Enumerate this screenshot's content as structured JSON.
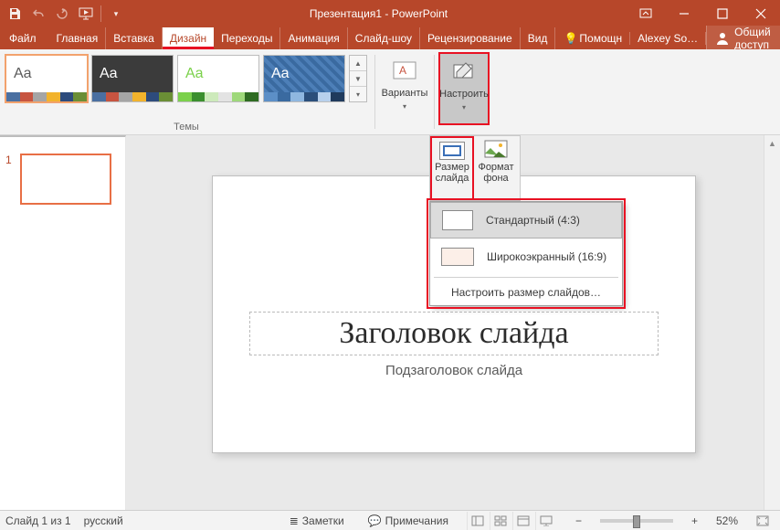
{
  "title": "Презентация1 - PowerPoint",
  "tabs": {
    "file": "Файл",
    "home": "Главная",
    "insert": "Вставка",
    "design": "Дизайн",
    "transitions": "Переходы",
    "animation": "Анимация",
    "slideshow": "Слайд-шоу",
    "review": "Рецензирование",
    "view": "Вид",
    "help": "Помощн",
    "account": "Alexey So…",
    "share": "Общий доступ"
  },
  "ribbon": {
    "themes_label": "Темы",
    "variants": "Варианты",
    "customize": "Настроить",
    "slide_size": "Размер слайда",
    "format_bg": "Формат фона"
  },
  "themes": [
    {
      "aa": "Aa",
      "color": "#5a5a5a",
      "bg": "#ffffff",
      "bars": [
        "#4a6fa1",
        "#c75440",
        "#a5a5a5",
        "#f2b32c",
        "#2d4b7c",
        "#6a8e35"
      ]
    },
    {
      "aa": "Aa",
      "color": "#ffffff",
      "bg": "#3b3b3b",
      "bars": [
        "#4a6fa1",
        "#c75440",
        "#a5a5a5",
        "#f2b32c",
        "#2d4b7c",
        "#6a8e35"
      ]
    },
    {
      "aa": "Aa",
      "color": "#7bd14b",
      "bg": "#ffffff",
      "bars": [
        "#7bd14b",
        "#3b8f2e",
        "#cdeabb",
        "#e3e3e3",
        "#9ed87a",
        "#2e6b22"
      ]
    },
    {
      "aa": "Aa",
      "color": "#ffffff",
      "bg": "pattern",
      "bars": [
        "#5c8fc7",
        "#3a6aa0",
        "#8fb7e0",
        "#2b4e7a",
        "#b7d0ec",
        "#1f3a5c"
      ]
    }
  ],
  "dropdown": {
    "standard": "Стандартный (4:3)",
    "widescreen": "Широкоэкранный (16:9)",
    "custom": "Настроить размер слайдов…"
  },
  "slide": {
    "number": "1",
    "title_placeholder": "Заголовок слайда",
    "subtitle_placeholder": "Подзаголовок слайда"
  },
  "status": {
    "slide_count": "Слайд 1 из 1",
    "language": "русский",
    "notes": "Заметки",
    "comments": "Примечания",
    "zoom": "52%"
  }
}
